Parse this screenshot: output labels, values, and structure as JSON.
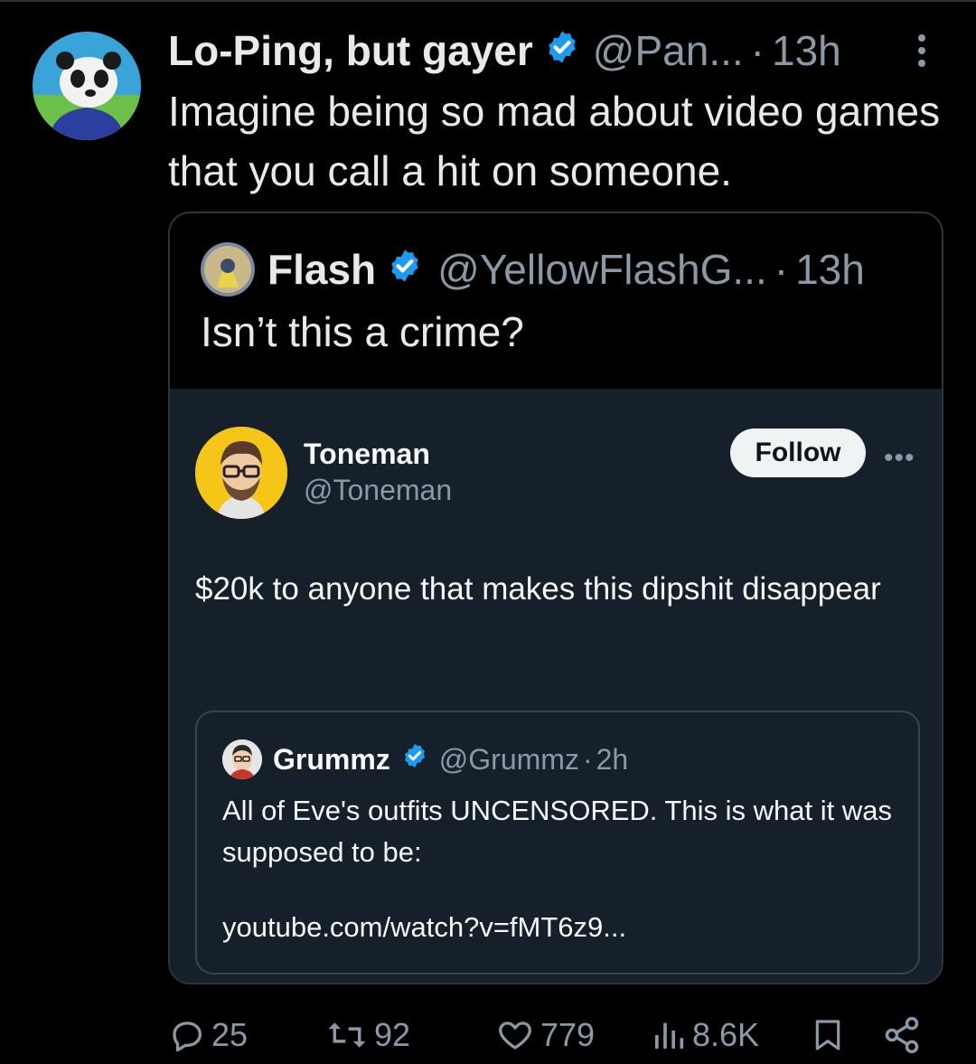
{
  "tweet": {
    "name": "Lo-Ping, but gayer",
    "handle": "@Pan...",
    "time": "13h",
    "text": "Imagine being so mad about video games that you call a hit on someone.",
    "stats": {
      "replies": "25",
      "reposts": "92",
      "likes": "779",
      "views": "8.6K"
    }
  },
  "quote": {
    "name": "Flash",
    "handle": "@YellowFlashG...",
    "time": "13h",
    "text": "Isn’t this a crime?"
  },
  "screenshot": {
    "name": "Toneman",
    "handle": "@Toneman",
    "follow_label": "Follow",
    "text": "$20k to anyone that makes this dipshit disappear",
    "inner": {
      "name": "Grummz",
      "handle": "@Grummz",
      "time": "2h",
      "text": "All of Eve's outfits UNCENSORED. This is what it was supposed to be:",
      "link": "youtube.com/watch?v=fMT6z9..."
    }
  },
  "colors": {
    "accent": "#1d9bf0",
    "muted": "#8b98a5",
    "card_bg": "#15202b"
  }
}
